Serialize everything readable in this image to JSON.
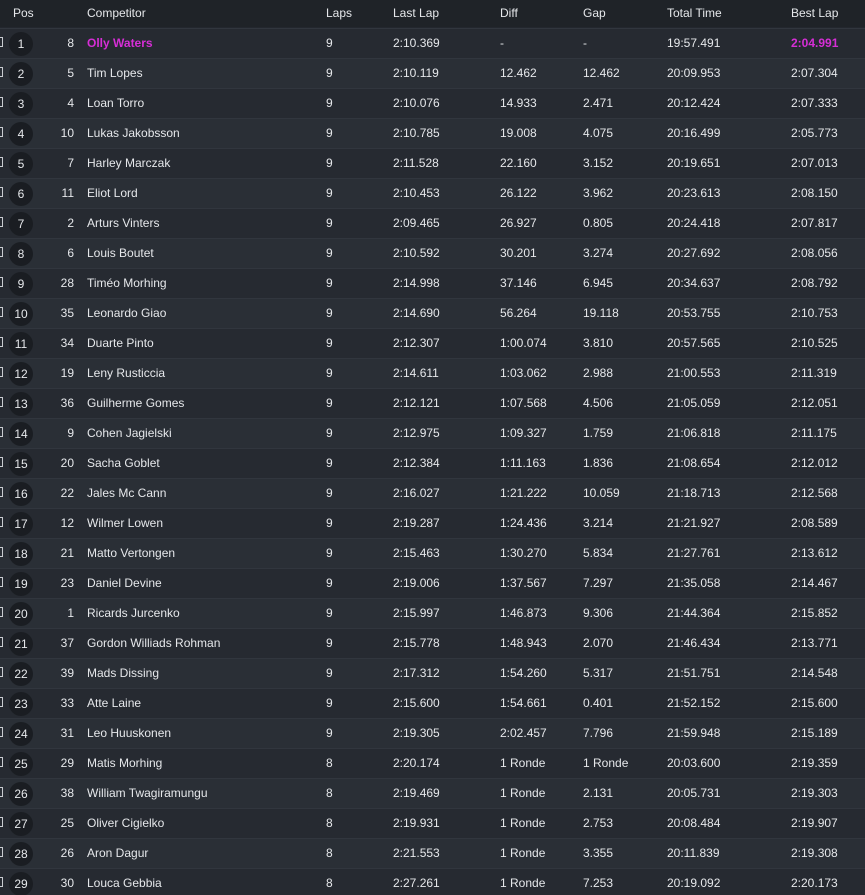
{
  "columns": {
    "pos": "Pos",
    "competitor": "Competitor",
    "laps": "Laps",
    "last_lap": "Last Lap",
    "diff": "Diff",
    "gap": "Gap",
    "total_time": "Total Time",
    "best_lap": "Best Lap"
  },
  "colors": {
    "leader_highlight": "#d62ed6",
    "row_bg": "#262a31",
    "row_bg_alt": "#2a2f36",
    "header_bg": "#1f2328"
  },
  "rows": [
    {
      "pos": "1",
      "num": "8",
      "competitor": "Olly Waters",
      "laps": "9",
      "last_lap": "2:10.369",
      "diff": "-",
      "gap": "-",
      "total_time": "19:57.491",
      "best_lap": "2:04.991",
      "highlight": true
    },
    {
      "pos": "2",
      "num": "5",
      "competitor": "Tim Lopes",
      "laps": "9",
      "last_lap": "2:10.119",
      "diff": "12.462",
      "gap": "12.462",
      "total_time": "20:09.953",
      "best_lap": "2:07.304"
    },
    {
      "pos": "3",
      "num": "4",
      "competitor": "Loan Torro",
      "laps": "9",
      "last_lap": "2:10.076",
      "diff": "14.933",
      "gap": "2.471",
      "total_time": "20:12.424",
      "best_lap": "2:07.333"
    },
    {
      "pos": "4",
      "num": "10",
      "competitor": "Lukas Jakobsson",
      "laps": "9",
      "last_lap": "2:10.785",
      "diff": "19.008",
      "gap": "4.075",
      "total_time": "20:16.499",
      "best_lap": "2:05.773"
    },
    {
      "pos": "5",
      "num": "7",
      "competitor": "Harley Marczak",
      "laps": "9",
      "last_lap": "2:11.528",
      "diff": "22.160",
      "gap": "3.152",
      "total_time": "20:19.651",
      "best_lap": "2:07.013"
    },
    {
      "pos": "6",
      "num": "11",
      "competitor": "Eliot Lord",
      "laps": "9",
      "last_lap": "2:10.453",
      "diff": "26.122",
      "gap": "3.962",
      "total_time": "20:23.613",
      "best_lap": "2:08.150"
    },
    {
      "pos": "7",
      "num": "2",
      "competitor": "Arturs Vinters",
      "laps": "9",
      "last_lap": "2:09.465",
      "diff": "26.927",
      "gap": "0.805",
      "total_time": "20:24.418",
      "best_lap": "2:07.817"
    },
    {
      "pos": "8",
      "num": "6",
      "competitor": "Louis Boutet",
      "laps": "9",
      "last_lap": "2:10.592",
      "diff": "30.201",
      "gap": "3.274",
      "total_time": "20:27.692",
      "best_lap": "2:08.056"
    },
    {
      "pos": "9",
      "num": "28",
      "competitor": "Timéo Morhing",
      "laps": "9",
      "last_lap": "2:14.998",
      "diff": "37.146",
      "gap": "6.945",
      "total_time": "20:34.637",
      "best_lap": "2:08.792"
    },
    {
      "pos": "10",
      "num": "35",
      "competitor": "Leonardo Giao",
      "laps": "9",
      "last_lap": "2:14.690",
      "diff": "56.264",
      "gap": "19.118",
      "total_time": "20:53.755",
      "best_lap": "2:10.753"
    },
    {
      "pos": "11",
      "num": "34",
      "competitor": "Duarte Pinto",
      "laps": "9",
      "last_lap": "2:12.307",
      "diff": "1:00.074",
      "gap": "3.810",
      "total_time": "20:57.565",
      "best_lap": "2:10.525"
    },
    {
      "pos": "12",
      "num": "19",
      "competitor": "Leny Rusticcia",
      "laps": "9",
      "last_lap": "2:14.611",
      "diff": "1:03.062",
      "gap": "2.988",
      "total_time": "21:00.553",
      "best_lap": "2:11.319"
    },
    {
      "pos": "13",
      "num": "36",
      "competitor": "Guilherme Gomes",
      "laps": "9",
      "last_lap": "2:12.121",
      "diff": "1:07.568",
      "gap": "4.506",
      "total_time": "21:05.059",
      "best_lap": "2:12.051"
    },
    {
      "pos": "14",
      "num": "9",
      "competitor": "Cohen Jagielski",
      "laps": "9",
      "last_lap": "2:12.975",
      "diff": "1:09.327",
      "gap": "1.759",
      "total_time": "21:06.818",
      "best_lap": "2:11.175"
    },
    {
      "pos": "15",
      "num": "20",
      "competitor": "Sacha Goblet",
      "laps": "9",
      "last_lap": "2:12.384",
      "diff": "1:11.163",
      "gap": "1.836",
      "total_time": "21:08.654",
      "best_lap": "2:12.012"
    },
    {
      "pos": "16",
      "num": "22",
      "competitor": "Jales Mc Cann",
      "laps": "9",
      "last_lap": "2:16.027",
      "diff": "1:21.222",
      "gap": "10.059",
      "total_time": "21:18.713",
      "best_lap": "2:12.568"
    },
    {
      "pos": "17",
      "num": "12",
      "competitor": "Wilmer Lowen",
      "laps": "9",
      "last_lap": "2:19.287",
      "diff": "1:24.436",
      "gap": "3.214",
      "total_time": "21:21.927",
      "best_lap": "2:08.589"
    },
    {
      "pos": "18",
      "num": "21",
      "competitor": "Matto Vertongen",
      "laps": "9",
      "last_lap": "2:15.463",
      "diff": "1:30.270",
      "gap": "5.834",
      "total_time": "21:27.761",
      "best_lap": "2:13.612"
    },
    {
      "pos": "19",
      "num": "23",
      "competitor": "Daniel Devine",
      "laps": "9",
      "last_lap": "2:19.006",
      "diff": "1:37.567",
      "gap": "7.297",
      "total_time": "21:35.058",
      "best_lap": "2:14.467"
    },
    {
      "pos": "20",
      "num": "1",
      "competitor": "Ricards Jurcenko",
      "laps": "9",
      "last_lap": "2:15.997",
      "diff": "1:46.873",
      "gap": "9.306",
      "total_time": "21:44.364",
      "best_lap": "2:15.852"
    },
    {
      "pos": "21",
      "num": "37",
      "competitor": "Gordon Williads Rohman",
      "laps": "9",
      "last_lap": "2:15.778",
      "diff": "1:48.943",
      "gap": "2.070",
      "total_time": "21:46.434",
      "best_lap": "2:13.771"
    },
    {
      "pos": "22",
      "num": "39",
      "competitor": "Mads Dissing",
      "laps": "9",
      "last_lap": "2:17.312",
      "diff": "1:54.260",
      "gap": "5.317",
      "total_time": "21:51.751",
      "best_lap": "2:14.548"
    },
    {
      "pos": "23",
      "num": "33",
      "competitor": "Atte Laine",
      "laps": "9",
      "last_lap": "2:15.600",
      "diff": "1:54.661",
      "gap": "0.401",
      "total_time": "21:52.152",
      "best_lap": "2:15.600"
    },
    {
      "pos": "24",
      "num": "31",
      "competitor": "Leo Huuskonen",
      "laps": "9",
      "last_lap": "2:19.305",
      "diff": "2:02.457",
      "gap": "7.796",
      "total_time": "21:59.948",
      "best_lap": "2:15.189"
    },
    {
      "pos": "25",
      "num": "29",
      "competitor": "Matis Morhing",
      "laps": "8",
      "last_lap": "2:20.174",
      "diff": "1 Ronde",
      "gap": "1 Ronde",
      "total_time": "20:03.600",
      "best_lap": "2:19.359"
    },
    {
      "pos": "26",
      "num": "38",
      "competitor": "William Twagiramungu",
      "laps": "8",
      "last_lap": "2:19.469",
      "diff": "1 Ronde",
      "gap": "2.131",
      "total_time": "20:05.731",
      "best_lap": "2:19.303"
    },
    {
      "pos": "27",
      "num": "25",
      "competitor": "Oliver Cigielko",
      "laps": "8",
      "last_lap": "2:19.931",
      "diff": "1 Ronde",
      "gap": "2.753",
      "total_time": "20:08.484",
      "best_lap": "2:19.907"
    },
    {
      "pos": "28",
      "num": "26",
      "competitor": "Aron Dagur",
      "laps": "8",
      "last_lap": "2:21.553",
      "diff": "1 Ronde",
      "gap": "3.355",
      "total_time": "20:11.839",
      "best_lap": "2:19.308"
    },
    {
      "pos": "29",
      "num": "30",
      "competitor": "Louca Gebbia",
      "laps": "8",
      "last_lap": "2:27.261",
      "diff": "1 Ronde",
      "gap": "7.253",
      "total_time": "20:19.092",
      "best_lap": "2:20.173"
    }
  ]
}
